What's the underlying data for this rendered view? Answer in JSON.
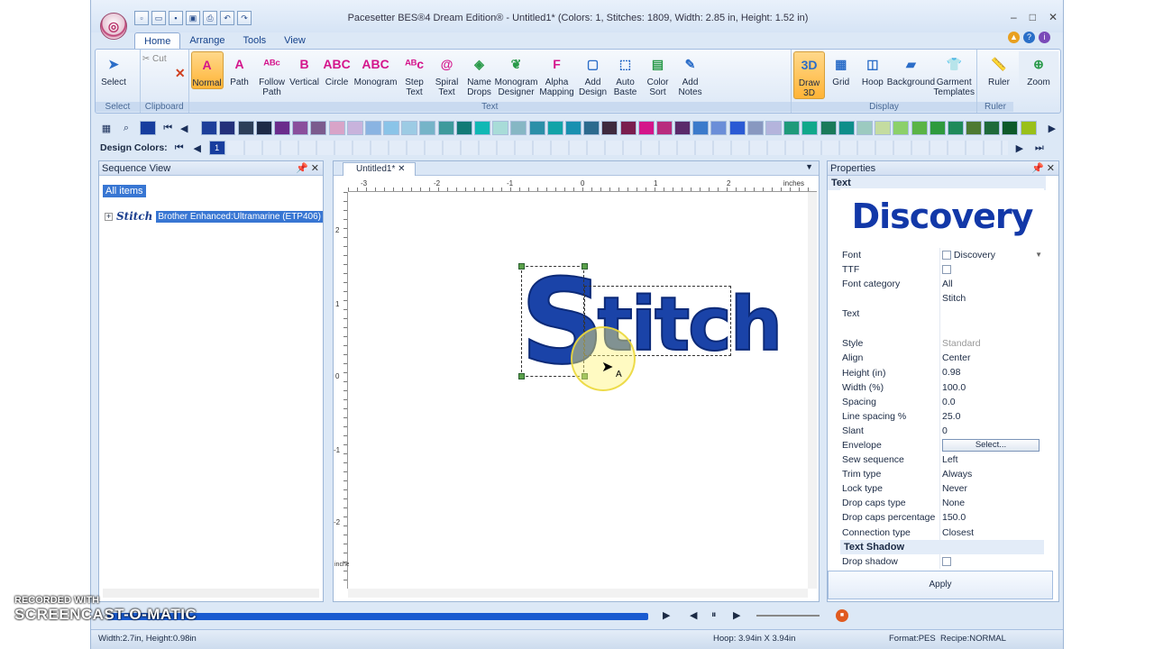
{
  "window": {
    "title": "Pacesetter BES®4 Dream Edition® - Untitled1* (Colors: 1, Stitches: 1809, Width: 2.85 in, Height: 1.52 in)"
  },
  "ribbon": {
    "tabs": [
      "Home",
      "Arrange",
      "Tools",
      "View"
    ],
    "groups": {
      "select": {
        "label": "Select",
        "buttons": [
          "Select"
        ]
      },
      "clipboard": {
        "label": "Clipboard",
        "buttons": [
          "Cut"
        ]
      },
      "text": {
        "label": "Text",
        "buttons": [
          "Normal",
          "Path",
          "Follow\nPath",
          "Vertical",
          "Circle",
          "Monogram",
          "Step\nText",
          "Spiral\nText",
          "Name\nDrops",
          "Monogram\nDesigner",
          "Alpha\nMapping",
          "Add\nDesign",
          "Auto\nBaste",
          "Color\nSort",
          "Add\nNotes"
        ]
      },
      "display": {
        "label": "Display",
        "buttons": [
          "Draw\n3D",
          "Grid",
          "Hoop",
          "Background",
          "Garment\nTemplates"
        ]
      },
      "ruler": {
        "label": "Ruler",
        "buttons": [
          "Ruler",
          "Zoom"
        ]
      }
    }
  },
  "palette": {
    "design_colors_label": "Design Colors:",
    "design_color_number": "1",
    "colors": [
      "#1d3f9a",
      "#23307a",
      "#2c3e58",
      "#1d2a46",
      "#6a2c8c",
      "#8a4f9c",
      "#7b5b8e",
      "#d8a4c8",
      "#c8b3dc",
      "#8ab4e2",
      "#8ac4e8",
      "#9ccbe4",
      "#76b4c8",
      "#3e9a9c",
      "#127a76",
      "#10b8b4",
      "#a8dcd8",
      "#86b7c4",
      "#2b8fa8",
      "#12a3a8",
      "#1890b0",
      "#2c6a8e",
      "#3e2a3e",
      "#7a1e4e",
      "#d4158a",
      "#b82c7e",
      "#5a2a6a",
      "#3a7acb",
      "#6a8ed8",
      "#2a5ad4",
      "#8898c0",
      "#b4b4dc",
      "#1e9a7a",
      "#10a88a",
      "#1a7a5a",
      "#0e8e8a",
      "#9ccac0",
      "#c4dca0",
      "#8cd06a",
      "#5ab446",
      "#2e9a3e",
      "#1e8a5a",
      "#4e7a32",
      "#1e6a3a",
      "#0e5a2a",
      "#9ac01a"
    ]
  },
  "sequence_view": {
    "title": "Sequence View",
    "all_items": "All items",
    "items": [
      {
        "thumb": "Stitch",
        "label": "Brother Enhanced:Ultramarine (ETP406)"
      }
    ]
  },
  "document": {
    "tab": "Untitled1*",
    "ruler_unit": "inches",
    "h_ticks": [
      "-3",
      "-2",
      "-1",
      "0",
      "1",
      "2"
    ],
    "v_ticks": [
      "2",
      "1",
      "0",
      "-1",
      "-2"
    ],
    "v_unit": "inches",
    "text_first": "S",
    "text_rest": "titch",
    "cursor_label": "A"
  },
  "properties": {
    "title": "Properties",
    "section_text": "Text",
    "font_preview": "Discovery",
    "rows": [
      {
        "key": "Font",
        "value": "Discovery"
      },
      {
        "key": "TTF",
        "value": ""
      },
      {
        "key": "Font category",
        "value": "All"
      },
      {
        "key": "Text",
        "value": "Stitch"
      },
      {
        "key": "Style",
        "value": "Standard"
      },
      {
        "key": "Align",
        "value": "Center"
      },
      {
        "key": "Height (in)",
        "value": "0.98"
      },
      {
        "key": "Width (%)",
        "value": "100.0"
      },
      {
        "key": "Spacing",
        "value": "0.0"
      },
      {
        "key": "Line spacing %",
        "value": "25.0"
      },
      {
        "key": "Slant",
        "value": "0"
      },
      {
        "key": "Envelope",
        "value": "Select..."
      },
      {
        "key": "Sew sequence",
        "value": "Left"
      },
      {
        "key": "Trim type",
        "value": "Always"
      },
      {
        "key": "Lock type",
        "value": "Never"
      },
      {
        "key": "Drop caps type",
        "value": "None"
      },
      {
        "key": "Drop caps percentage",
        "value": "150.0"
      },
      {
        "key": "Connection type",
        "value": "Closest"
      }
    ],
    "section_shadow": "Text Shadow",
    "shadow_row": {
      "key": "Drop shadow",
      "value": ""
    },
    "apply": "Apply"
  },
  "statusbar": {
    "left": "Width:2.7in, Height:0.98in",
    "hoop": "Hoop: 3.94in X 3.94in",
    "format": "Format:PES",
    "recipe": "Recipe:NORMAL"
  },
  "watermark": {
    "recorded": "RECORDED WITH",
    "brand": "SCREENCAST-O-MATIC"
  }
}
